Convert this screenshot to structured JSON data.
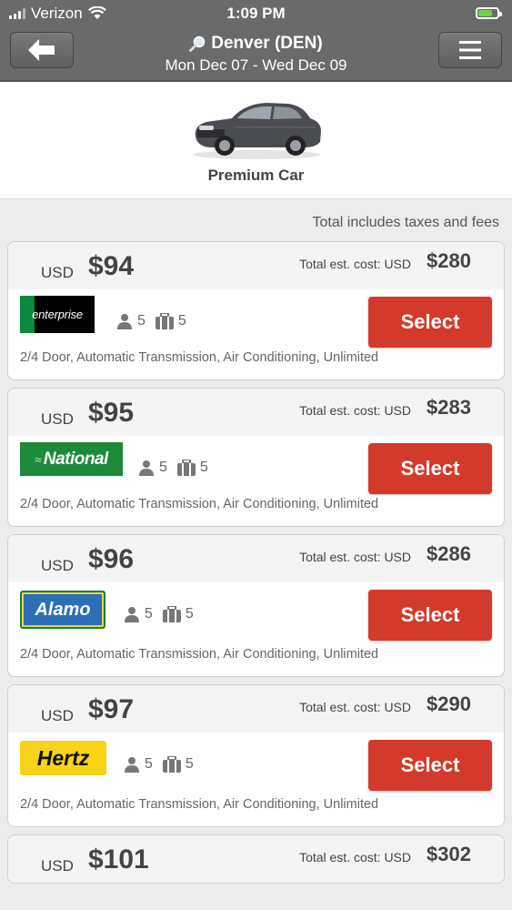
{
  "status_bar": {
    "carrier": "Verizon",
    "time": "1:09 PM"
  },
  "header": {
    "city": "Denver (DEN)",
    "dates": "Mon Dec 07 - Wed Dec 09"
  },
  "car": {
    "class_name": "Premium Car"
  },
  "note": "Total includes taxes and fees",
  "colors": {
    "select_button": "#d33a2c",
    "header_bg": "#6a6a6a"
  },
  "offers": [
    {
      "currency": "USD",
      "price": "$94",
      "total_label": "Total est. cost:",
      "total_currency": "USD",
      "total": "$280",
      "vendor": "enterprise",
      "passengers": "5",
      "bags": "5",
      "select_label": "Select",
      "desc": "2/4 Door, Automatic Transmission, Air Conditioning, Unlimited"
    },
    {
      "currency": "USD",
      "price": "$95",
      "total_label": "Total est. cost:",
      "total_currency": "USD",
      "total": "$283",
      "vendor": "National",
      "passengers": "5",
      "bags": "5",
      "select_label": "Select",
      "desc": "2/4 Door, Automatic Transmission, Air Conditioning, Unlimited"
    },
    {
      "currency": "USD",
      "price": "$96",
      "total_label": "Total est. cost:",
      "total_currency": "USD",
      "total": "$286",
      "vendor": "Alamo",
      "passengers": "5",
      "bags": "5",
      "select_label": "Select",
      "desc": "2/4 Door, Automatic Transmission, Air Conditioning, Unlimited"
    },
    {
      "currency": "USD",
      "price": "$97",
      "total_label": "Total est. cost:",
      "total_currency": "USD",
      "total": "$290",
      "vendor": "Hertz",
      "passengers": "5",
      "bags": "5",
      "select_label": "Select",
      "desc": "2/4 Door, Automatic Transmission, Air Conditioning, Unlimited"
    },
    {
      "currency": "USD",
      "price": "$101",
      "total_label": "Total est. cost:",
      "total_currency": "USD",
      "total": "$302"
    }
  ]
}
